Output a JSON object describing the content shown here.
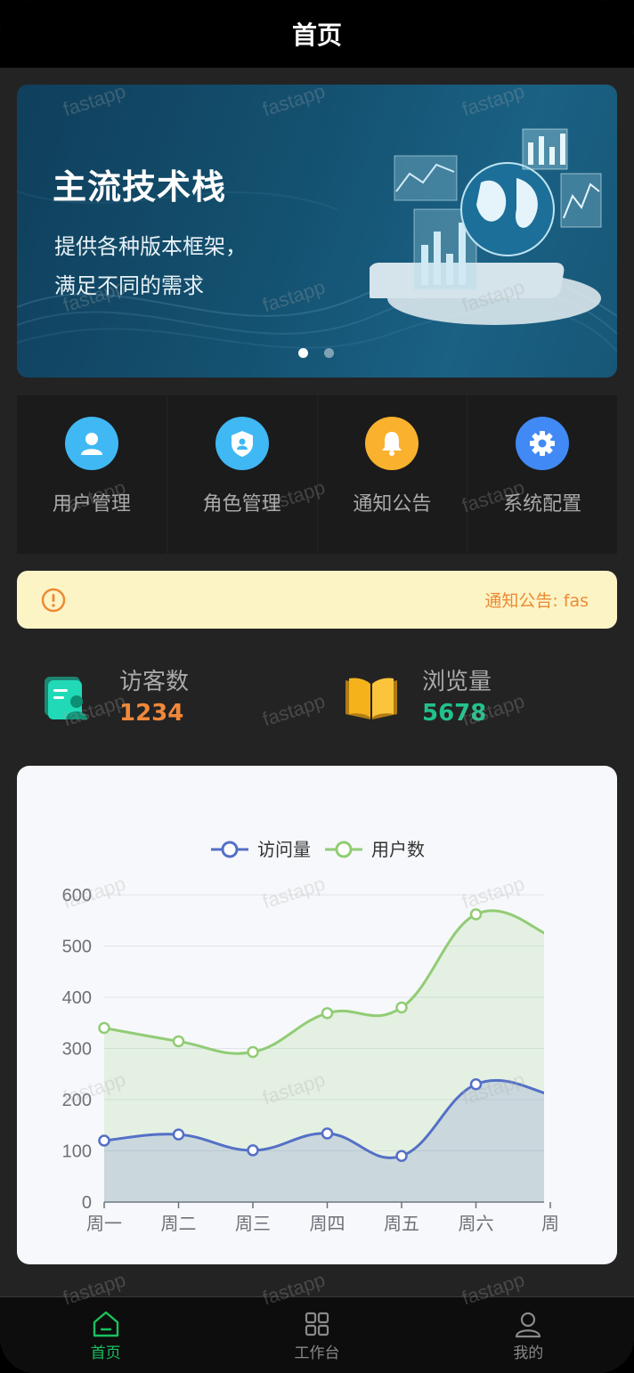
{
  "navbar": {
    "title": "首页"
  },
  "banner": {
    "title": "主流技术栈",
    "subtitle_line1": "提供各种版本框架，",
    "subtitle_line2": "满足不同的需求",
    "slide_count": 2,
    "active_slide": 0
  },
  "grid": [
    {
      "label": "用户管理",
      "icon": "user-icon",
      "color": "#3fb8f4"
    },
    {
      "label": "角色管理",
      "icon": "shield-icon",
      "color": "#3fb8f4"
    },
    {
      "label": "通知公告",
      "icon": "bell-icon",
      "color": "#f9b12e"
    },
    {
      "label": "系统配置",
      "icon": "gear-icon",
      "color": "#4189f5"
    }
  ],
  "notice": {
    "text": "通知公告: fas",
    "icon": "exclamation-circle-icon",
    "color": "#ed8a33"
  },
  "stats": [
    {
      "label": "访客数",
      "value": "1234",
      "color": "#f0883a",
      "icon": "visitor-card-icon"
    },
    {
      "label": "浏览量",
      "value": "5678",
      "color": "#22c28a",
      "icon": "book-icon"
    }
  ],
  "chart_data": {
    "type": "area",
    "categories": [
      "周一",
      "周二",
      "周三",
      "周四",
      "周五",
      "周六",
      "周日"
    ],
    "visible_categories": [
      "周一",
      "周二",
      "周三",
      "周四",
      "周五",
      "周六",
      "周"
    ],
    "series": [
      {
        "name": "访问量",
        "values": [
          120,
          132,
          101,
          134,
          90,
          230,
          210
        ],
        "color": "#5470c6"
      },
      {
        "name": "用户数",
        "values": [
          340,
          314,
          293,
          369,
          380,
          562,
          520
        ],
        "color": "#91cc75"
      }
    ],
    "ylim": [
      0,
      600
    ],
    "yticks": [
      0,
      100,
      200,
      300,
      400,
      500,
      600
    ],
    "legend": "top-center",
    "grid": true,
    "smooth": true
  },
  "tabbar": [
    {
      "label": "首页",
      "icon": "home-icon",
      "active": true
    },
    {
      "label": "工作台",
      "icon": "grid-icon",
      "active": false
    },
    {
      "label": "我的",
      "icon": "person-icon",
      "active": false
    }
  ],
  "watermark": "fastapp",
  "colors": {
    "accent": "#19c15f",
    "background": "#232323"
  }
}
